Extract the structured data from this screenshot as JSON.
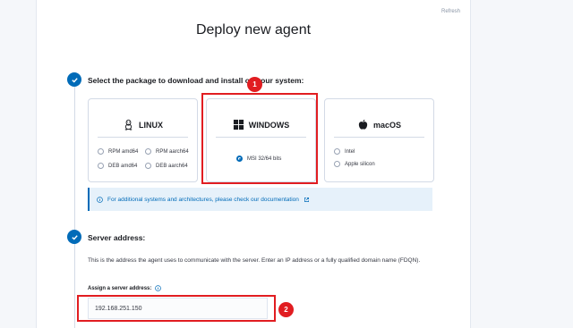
{
  "header": {
    "refresh_label": "Refresh",
    "title": "Deploy new agent"
  },
  "steps": [
    {
      "title": "Select the package to download and install on your system:"
    },
    {
      "title": "Server address:"
    }
  ],
  "packages": {
    "linux": {
      "label": "LINUX",
      "options": [
        "RPM amd64",
        "RPM aarch64",
        "DEB amd64",
        "DEB aarch64"
      ]
    },
    "windows": {
      "label": "WINDOWS",
      "options": [
        "MSI 32/64 bits"
      ],
      "selected": "MSI 32/64 bits"
    },
    "macos": {
      "label": "macOS",
      "options": [
        "Intel",
        "Apple silicon"
      ]
    }
  },
  "callout": {
    "text": "For additional systems and architectures, please check our documentation"
  },
  "server": {
    "description": "This is the address the agent uses to communicate with the server. Enter an IP address or a fully qualified domain name (FDQN).",
    "field_label": "Assign a server address:",
    "value": "192.168.251.150"
  },
  "annotations": {
    "badge_1": "1",
    "badge_2": "2",
    "highlight_color": "#e11d21"
  },
  "colors": {
    "accent": "#006bb8",
    "callout_bg": "#e6f1fa"
  }
}
